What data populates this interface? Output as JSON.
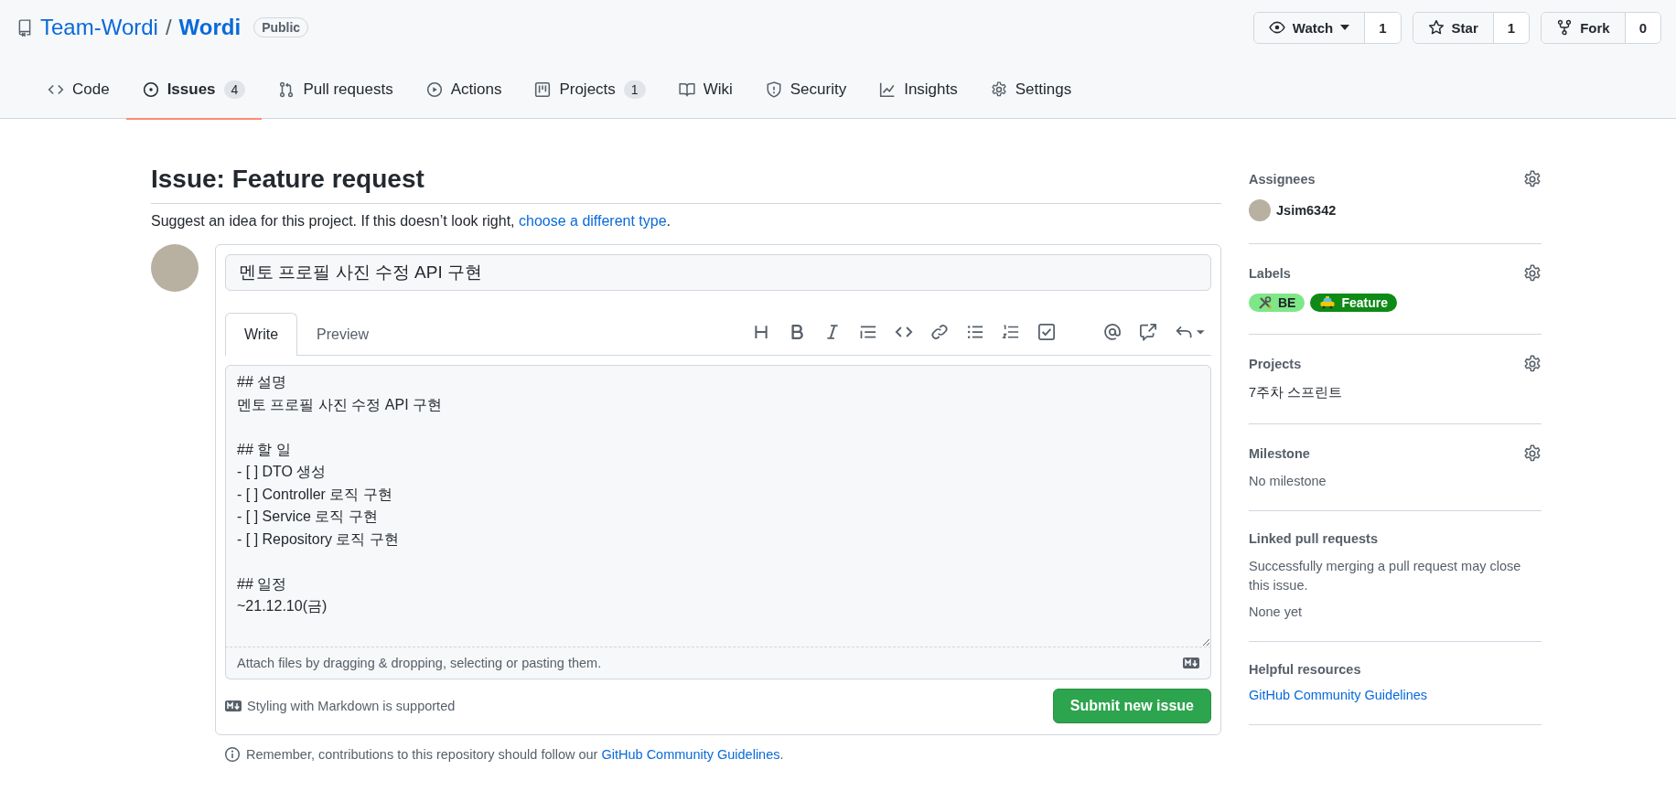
{
  "repo": {
    "owner": "Team-Wordi",
    "separator": "/",
    "name": "Wordi",
    "visibility": "Public"
  },
  "actions": [
    {
      "kind": "watch",
      "label": "Watch",
      "count": "1"
    },
    {
      "kind": "star",
      "label": "Star",
      "count": "1"
    },
    {
      "kind": "fork",
      "label": "Fork",
      "count": "0"
    }
  ],
  "tabs": [
    {
      "kind": "code",
      "label": "Code",
      "selected": false
    },
    {
      "kind": "issues",
      "label": "Issues",
      "counter": "4",
      "selected": true
    },
    {
      "kind": "pulls",
      "label": "Pull requests",
      "selected": false
    },
    {
      "kind": "actions",
      "label": "Actions",
      "selected": false
    },
    {
      "kind": "projects",
      "label": "Projects",
      "counter": "1",
      "selected": false
    },
    {
      "kind": "wiki",
      "label": "Wiki",
      "selected": false
    },
    {
      "kind": "security",
      "label": "Security",
      "selected": false
    },
    {
      "kind": "insights",
      "label": "Insights",
      "selected": false
    },
    {
      "kind": "settings",
      "label": "Settings",
      "selected": false
    }
  ],
  "page_title": "Issue: Feature request",
  "subtitle": {
    "text": "Suggest an idea for this project. If this doesn’t look right,",
    "link": "choose a different type",
    "end": "."
  },
  "issue_title": "멘토 프로필 사진 수정 API 구현",
  "editor_tabs": [
    {
      "label": "Write",
      "selected": true
    },
    {
      "label": "Preview",
      "selected": false
    }
  ],
  "body": "## 설명\n멘토 프로필 사진 수정 API 구현\n\n## 할 일\n- [ ] DTO 생성\n- [ ] Controller 로직 구현\n- [ ] Service 로직 구현\n- [ ] Repository 로직 구현\n\n## 일정\n~21.12.10(금)",
  "attach_hint": "Attach files by dragging & dropping, selecting or pasting them.",
  "markdown_note": "Styling with Markdown is supported",
  "submit": "Submit new issue",
  "remember": {
    "text": "Remember, contributions to this repository should follow our",
    "link": "GitHub Community Guidelines",
    "end": "."
  },
  "sidebar": {
    "assignees": {
      "title": "Assignees",
      "user": "Jsim6342"
    },
    "labels": {
      "title": "Labels",
      "items": [
        {
          "kind": "tools",
          "name": "BE",
          "color": "#7ee787"
        },
        {
          "kind": "taxi",
          "name": "Feature",
          "color": "#0e8a16"
        }
      ]
    },
    "projects": {
      "title": "Projects",
      "value": "7주차 스프린트"
    },
    "milestone": {
      "title": "Milestone",
      "value": "No milestone"
    },
    "linked": {
      "title": "Linked pull requests",
      "note": "Successfully merging a pull request may close this issue.",
      "value": "None yet"
    },
    "resources": {
      "title": "Helpful resources",
      "link": "GitHub Community Guidelines"
    }
  }
}
